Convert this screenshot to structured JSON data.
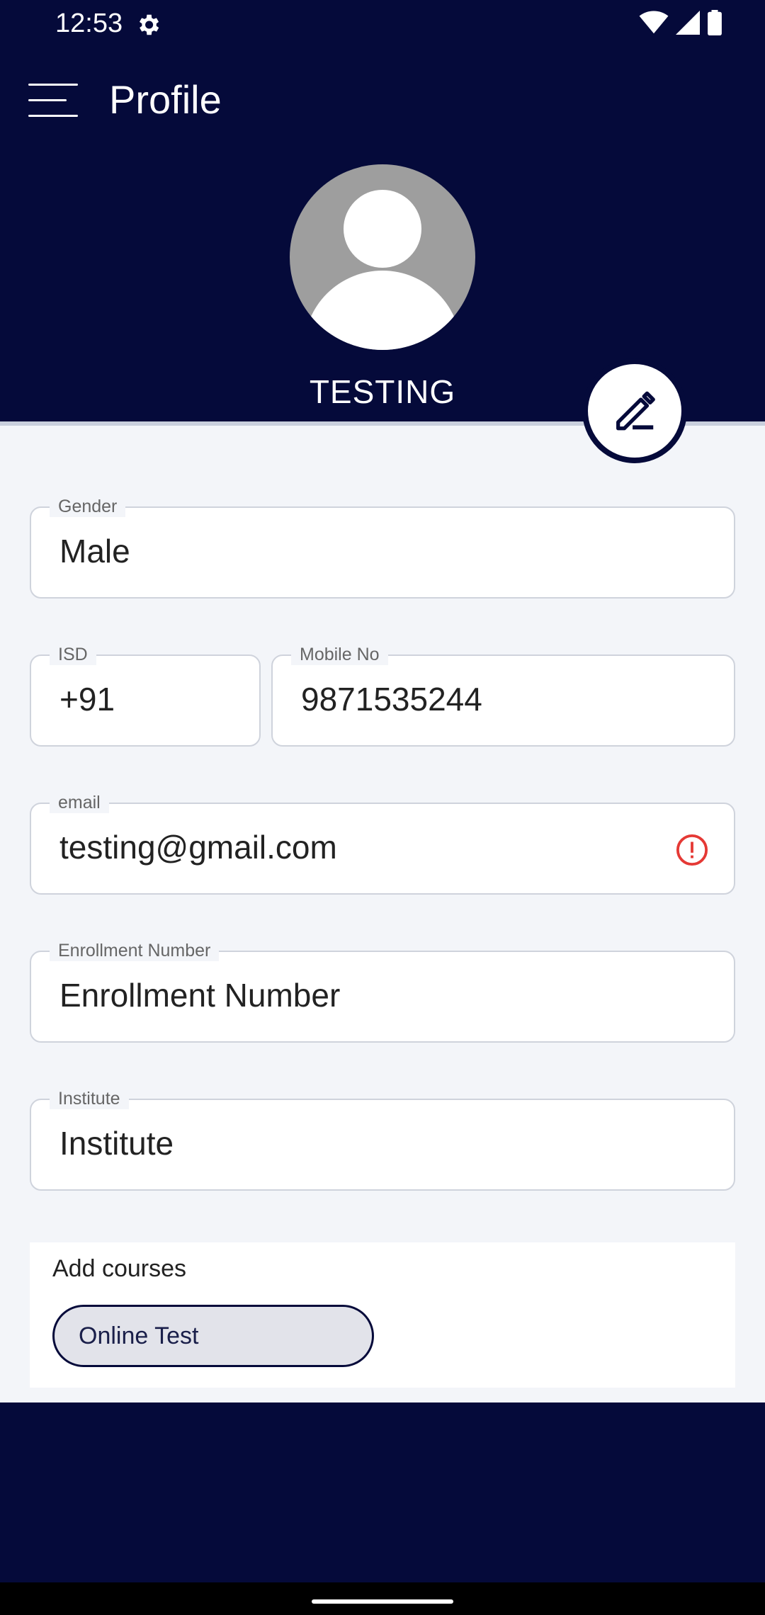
{
  "status_bar": {
    "time": "12:53",
    "icons": [
      "settings-icon",
      "wifi-icon",
      "signal-icon",
      "battery-icon"
    ]
  },
  "app_bar": {
    "title": "Profile",
    "menu_icon": "menu-icon"
  },
  "profile": {
    "name": "TESTING",
    "avatar_icon": "avatar-placeholder-icon",
    "edit_icon": "pencil-icon"
  },
  "form": {
    "gender": {
      "label": "Gender",
      "value": "Male"
    },
    "isd": {
      "label": "ISD",
      "value": "+91"
    },
    "mobile": {
      "label": "Mobile No",
      "value": "9871535244"
    },
    "email": {
      "label": "email",
      "value": "testing@gmail.com",
      "status_icon": "error-icon"
    },
    "enrollment": {
      "label": "Enrollment Number",
      "value": "Enrollment Number"
    },
    "institute": {
      "label": "Institute",
      "value": "Institute"
    }
  },
  "courses": {
    "title": "Add courses",
    "items": [
      {
        "label": "Online Test"
      }
    ]
  },
  "colors": {
    "primary_dark": "#050a3a",
    "background": "#f3f5f9",
    "error": "#e53935",
    "chip_bg": "#e2e3ea"
  }
}
